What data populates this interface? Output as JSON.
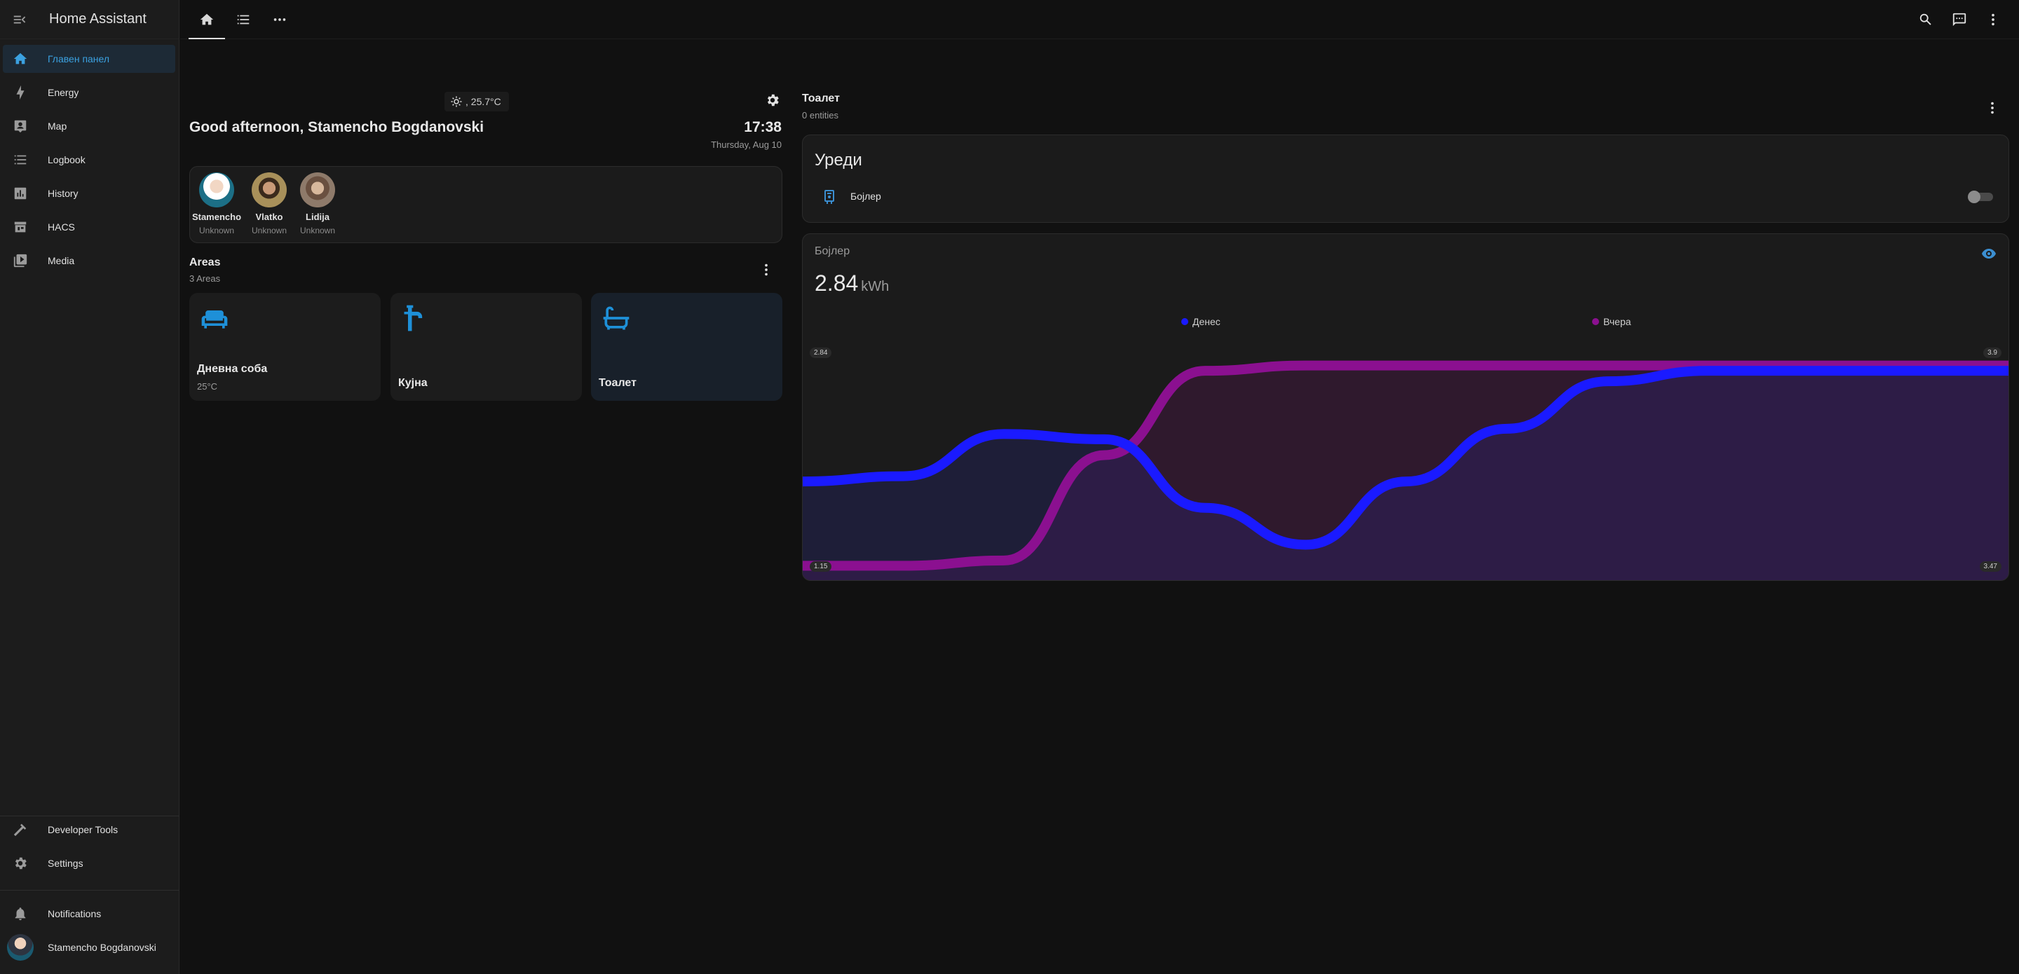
{
  "app": {
    "title": "Home Assistant"
  },
  "sidebar": {
    "items": [
      {
        "label": "Главен панел",
        "icon": "home-dashboard-icon",
        "active": true
      },
      {
        "label": "Energy",
        "icon": "lightning-bolt-icon"
      },
      {
        "label": "Map",
        "icon": "map-account-icon"
      },
      {
        "label": "Logbook",
        "icon": "format-list-bulleted-icon"
      },
      {
        "label": "History",
        "icon": "chart-box-icon"
      },
      {
        "label": "HACS",
        "icon": "hacs-store-icon"
      },
      {
        "label": "Media",
        "icon": "play-box-multiple-icon"
      }
    ],
    "bottom": {
      "developer_tools": "Developer Tools",
      "settings": "Settings",
      "notifications": "Notifications",
      "user": "Stamencho Bogdanovski"
    }
  },
  "topbar": {
    "tabs": [
      "home-icon",
      "list-icon",
      "more-horizontal-icon"
    ],
    "actions": [
      "search-icon",
      "assist-chat-icon",
      "more-vertical-icon"
    ]
  },
  "home": {
    "weather": ", 25.7°C",
    "greeting": "Good afternoon, Stamencho Bogdanovski",
    "time": "17:38",
    "date": "Thursday, Aug 10",
    "persons": [
      {
        "name": "Stamencho",
        "state": "Unknown"
      },
      {
        "name": "Vlatko",
        "state": "Unknown"
      },
      {
        "name": "Lidija",
        "state": "Unknown"
      }
    ],
    "areas_title": "Areas",
    "areas_sub": "3 Areas",
    "areas": [
      {
        "name": "Дневна соба",
        "temp": "25°C",
        "icon": "sofa-icon"
      },
      {
        "name": "Кујна",
        "temp": "",
        "icon": "faucet-icon"
      },
      {
        "name": "Тоалет",
        "temp": "",
        "icon": "bathtub-icon"
      }
    ]
  },
  "room": {
    "title": "Тоалет",
    "subtitle": "0 entities",
    "devices_card": {
      "title": "Уреди",
      "entity": "Бојлер",
      "entity_icon": "water-boiler-icon",
      "state": "off"
    },
    "energy_card": {
      "name": "Бојлер",
      "value": "2.84",
      "unit": "kWh",
      "badges": {
        "top_left": "2.84",
        "top_right": "3.9",
        "bottom_left": "1.15",
        "bottom_right": "3.47"
      }
    }
  },
  "colors": {
    "accent": "#1e90d8",
    "today": "#1a1aff",
    "yesterday": "#8b1090",
    "background": "#111111",
    "card": "#1b1b1b"
  },
  "chart_data": {
    "type": "area",
    "x": [
      0,
      1,
      2,
      3,
      4,
      5,
      6,
      7,
      8,
      9,
      10,
      11,
      12
    ],
    "series": [
      {
        "name": "Денес",
        "values": [
          1.95,
          2.0,
          2.4,
          2.35,
          1.7,
          1.35,
          1.95,
          2.45,
          2.9,
          3.0,
          3.0,
          3.0,
          3.0
        ]
      },
      {
        "name": "Вчера",
        "values": [
          1.15,
          1.15,
          1.2,
          2.2,
          3.0,
          3.05,
          3.05,
          3.05,
          3.05,
          3.05,
          3.05,
          3.05,
          3.05
        ]
      }
    ],
    "ylim": [
      1.0,
      3.3
    ],
    "grid": false,
    "legend": "top"
  }
}
